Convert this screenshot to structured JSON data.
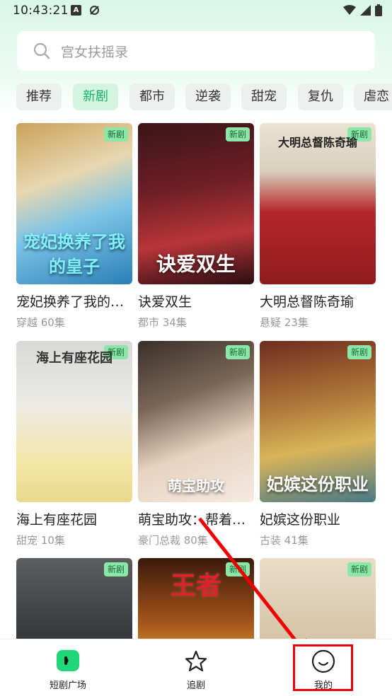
{
  "status_bar": {
    "time": "10:43:21"
  },
  "search": {
    "placeholder": "宫女扶摇录"
  },
  "tabs": [
    "推荐",
    "新剧",
    "都市",
    "逆袭",
    "甜宠",
    "复仇",
    "虐恋"
  ],
  "active_tab": "新剧",
  "badge_label": "新剧",
  "dramas": [
    {
      "title": "宠妃换养了我的…",
      "meta": "穿越 60集",
      "poster_text": "宠妃换养了我的皇子"
    },
    {
      "title": "诀爱双生",
      "meta": "都市 34集",
      "poster_text": "诀爱双生"
    },
    {
      "title": "大明总督陈奇瑜",
      "meta": "悬疑 23集",
      "poster_text": "大明总督陈奇瑜"
    },
    {
      "title": "海上有座花园",
      "meta": "甜宠 10集",
      "poster_text": "海上有座花园"
    },
    {
      "title": "萌宝助攻：帮着…",
      "meta": "豪门总裁 80集",
      "poster_text": "萌宝助攻"
    },
    {
      "title": "妃嫔这份职业",
      "meta": "古装 41集",
      "poster_text": "妃嫔这份职业"
    },
    {
      "title": "",
      "meta": "",
      "poster_text": ""
    },
    {
      "title": "",
      "meta": "",
      "poster_text": "王者"
    },
    {
      "title": "",
      "meta": "",
      "poster_text": ""
    }
  ],
  "bottom_nav": [
    {
      "label": "短剧广场",
      "icon": "play-square-icon"
    },
    {
      "label": "追剧",
      "icon": "star-icon"
    },
    {
      "label": "我的",
      "icon": "smile-face-icon"
    }
  ],
  "colors": {
    "accent": "#12b366",
    "badge": "#8be6a8",
    "annotation": "#e00000"
  }
}
